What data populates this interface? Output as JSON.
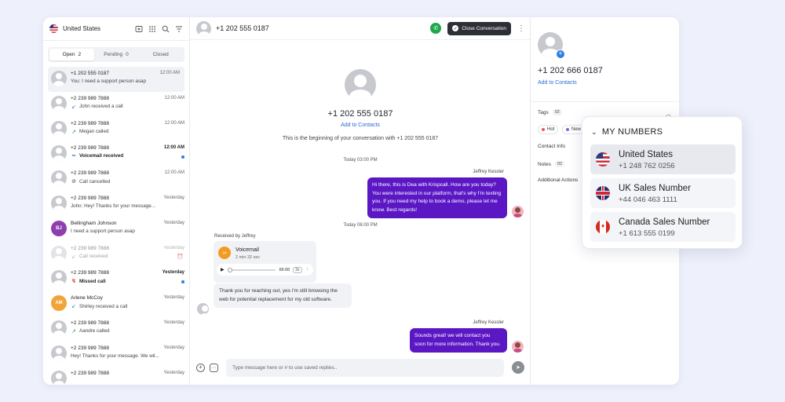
{
  "sidebar": {
    "country": "United States",
    "tabs": [
      {
        "label": "Open",
        "count": "2"
      },
      {
        "label": "Pending",
        "count": "0"
      },
      {
        "label": "Closed",
        "count": ""
      }
    ],
    "conversations": [
      {
        "name": "+1 202 555 0187",
        "time": "12:00 AM",
        "preview": "You: I need a support person asap",
        "icon": ""
      },
      {
        "name": "+2 239 989 7888",
        "time": "12:00 AM",
        "preview": "John received a call",
        "icon": "incoming-call-icon"
      },
      {
        "name": "+2 239 989 7888",
        "time": "12:00 AM",
        "preview": "Megan called",
        "icon": "outgoing-call-icon"
      },
      {
        "name": "+2 239 989 7888",
        "time": "12:00 AM",
        "preview": "Voicemail received",
        "icon": "voicemail-icon"
      },
      {
        "name": "+2 239 989 7888",
        "time": "12:00 AM",
        "preview": "Call cancelled",
        "icon": "cancelled-icon"
      },
      {
        "name": "+2 239 989 7888",
        "time": "Yesterday",
        "preview": "John: Hey! Thanks for your message...",
        "icon": ""
      },
      {
        "name": "Bellingham Johnson",
        "time": "Yesterday",
        "preview": "I need a support person asap",
        "icon": "",
        "initials": "BJ"
      },
      {
        "name": "+2 239 989 7888",
        "time": "Yesterday",
        "preview": "Call received",
        "icon": "incoming-call-icon"
      },
      {
        "name": "+2 239 989 7888",
        "time": "Yesterday",
        "preview": "Missed call",
        "icon": "missed-call-icon"
      },
      {
        "name": "Arlene McCoy",
        "time": "Yesterday",
        "preview": "Shirley received a call",
        "icon": "incoming-call-icon",
        "initials": "AM"
      },
      {
        "name": "+2 239 989 7888",
        "time": "Yesterday",
        "preview": "Aandre called",
        "icon": "outgoing-call-icon"
      },
      {
        "name": "+2 239 989 7888",
        "time": "Yesterday",
        "preview": "Hey! Thanks for your message. We wil...",
        "icon": ""
      },
      {
        "name": "+2 239 989 7888",
        "time": "Yesterday",
        "preview": "",
        "icon": ""
      }
    ]
  },
  "chat": {
    "title": "+1 202 555 0187",
    "close_label": "Close Conversation",
    "intro_number": "+1 202 555 0187",
    "add_contacts": "Add to Contacts",
    "intro_text": "This is the beginning of your conversation with +1 202 555 0187",
    "day1": "Today 03:00 PM",
    "sender1": "Jeffrey Kessler",
    "msg1": "Hi there, this is Dea with Krispcall. How are you today? You were interested in our platform, that's why I'm texting you. If you need my help to book a demo, please let me know. Best regards!",
    "day2": "Today 06:00 PM",
    "received_by": "Received by Jeffrey",
    "voicemail": {
      "title": "Voicemail",
      "duration": "2 min 32 sec",
      "time": "88:88",
      "speed": "2x"
    },
    "incoming_msg": "Thank you for reaching out, yes i'm still browsing the web for potential replacement for my old software.",
    "sender2": "Jeffrey Kessler",
    "msg2": "Sounds great! we will contact you soon for more information. Thank you.",
    "composer_placeholder": "Type message here or # to use saved replies.."
  },
  "contact": {
    "number": "+1 202 666 0187",
    "add_contacts": "Add to Contacts",
    "tags_label": "Tags",
    "tags_count": "02",
    "tags": [
      {
        "label": "Hot",
        "color": "#e85a5a"
      },
      {
        "label": "New",
        "color": "#7b6ae0"
      }
    ],
    "contact_info": "Contact Info",
    "notes_label": "Notes",
    "notes_count": "02",
    "additional": "Additional Actions"
  },
  "my_numbers": {
    "title": "MY NUMBERS",
    "items": [
      {
        "name": "United States",
        "number": "+1 248 762 0256"
      },
      {
        "name": "UK Sales Number",
        "number": "+44 046 463 1111"
      },
      {
        "name": "Canada Sales Number",
        "number": "+1 613 555 0199"
      }
    ]
  },
  "colors": {
    "accent": "#5b17c4",
    "link": "#2d6ad8",
    "call_green": "#1ea84c",
    "unread_dot": "#2d7be5"
  }
}
